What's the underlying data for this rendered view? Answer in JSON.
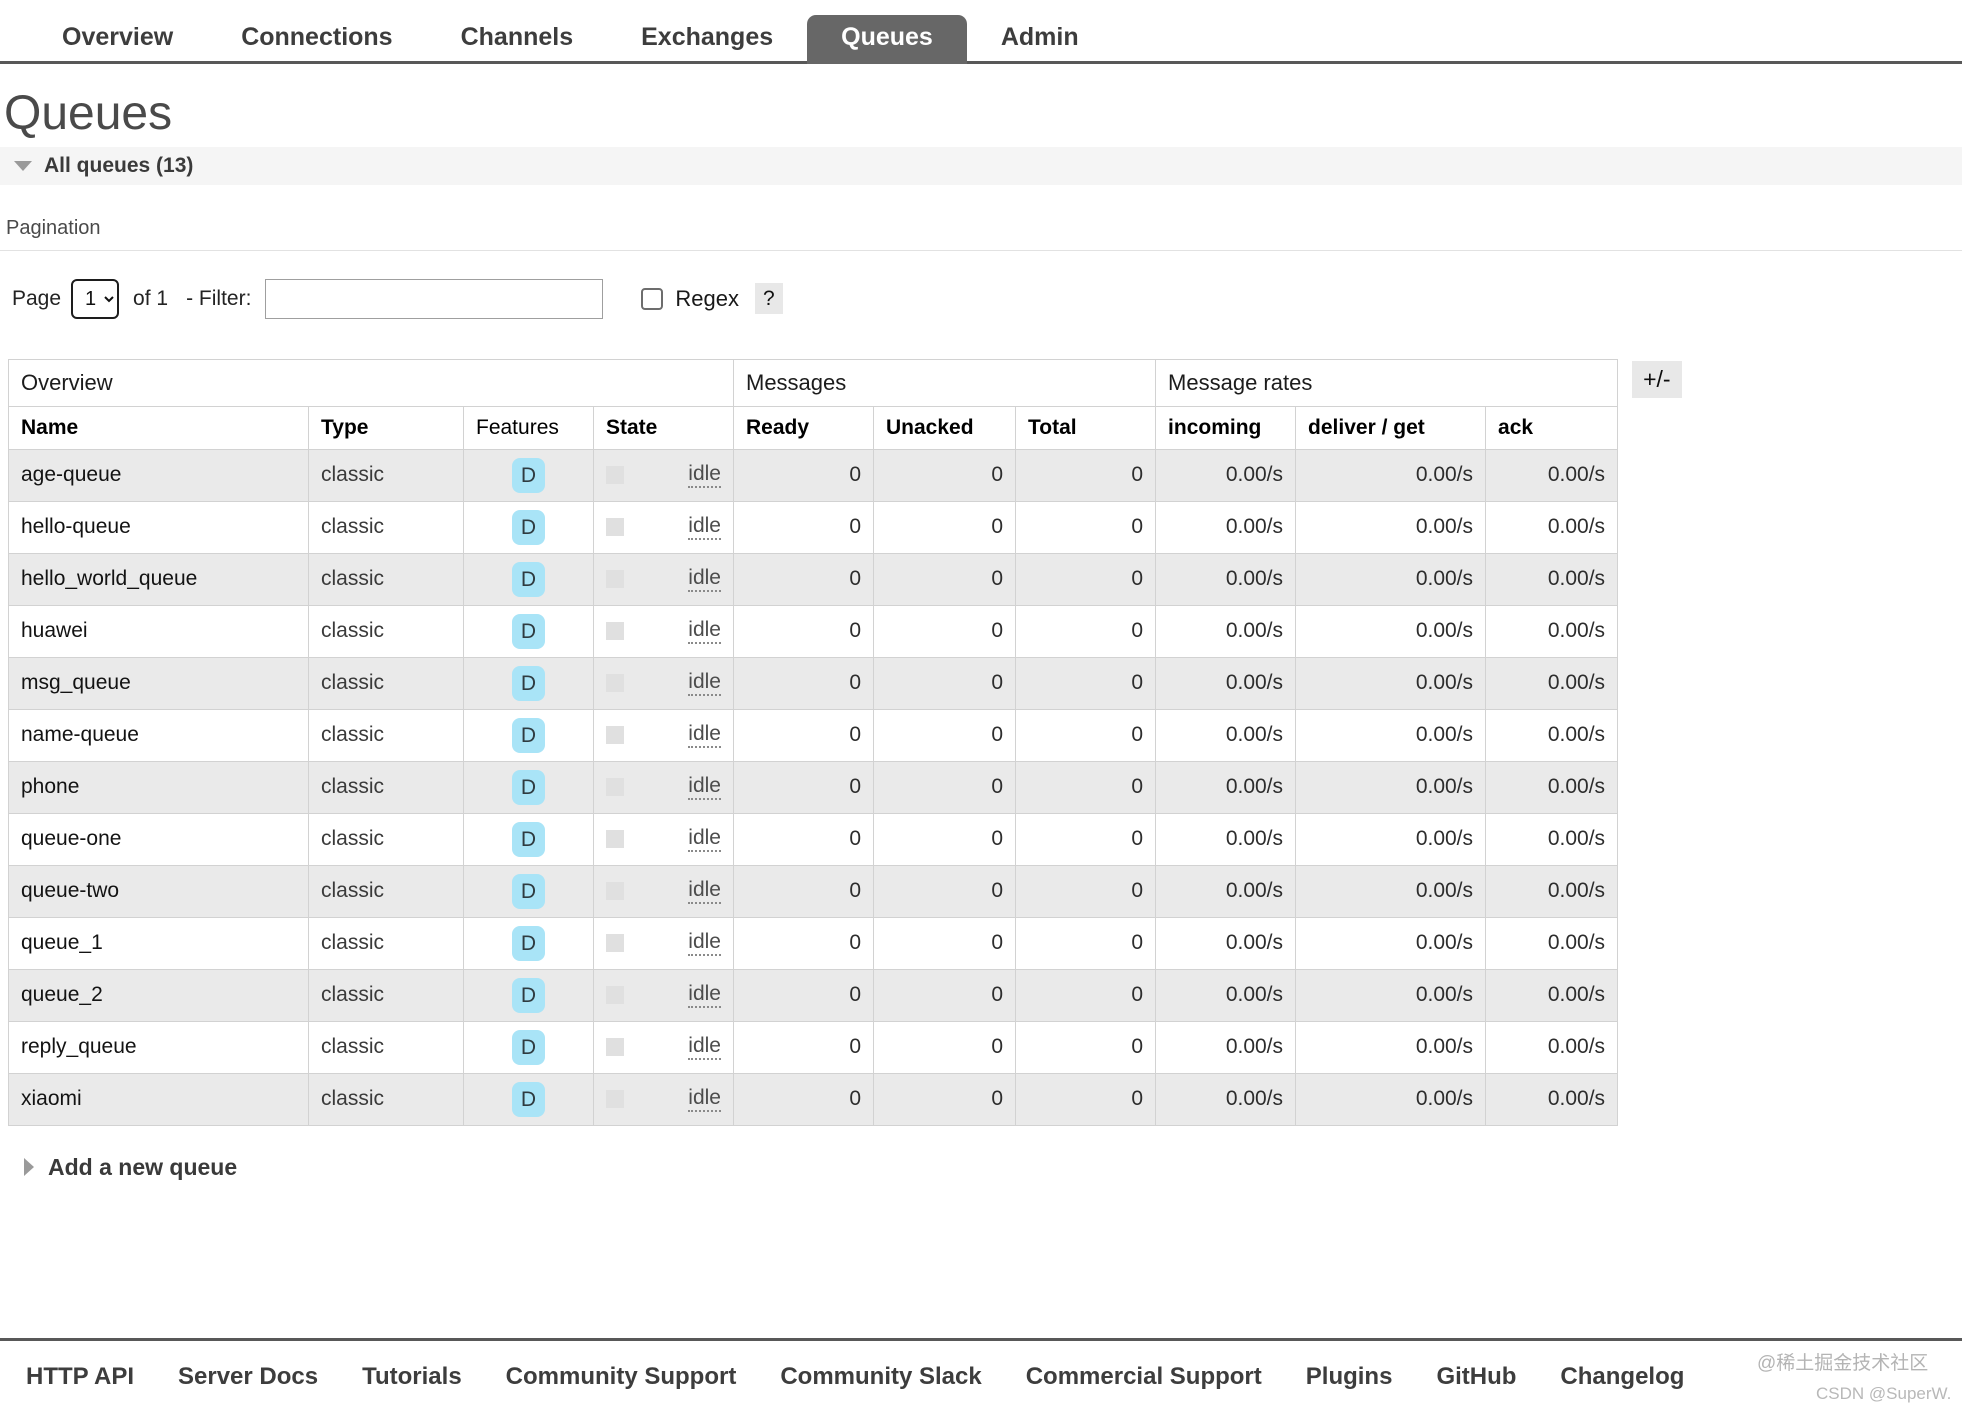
{
  "nav": {
    "tabs": [
      {
        "label": "Overview",
        "active": false
      },
      {
        "label": "Connections",
        "active": false
      },
      {
        "label": "Channels",
        "active": false
      },
      {
        "label": "Exchanges",
        "active": false
      },
      {
        "label": "Queues",
        "active": true
      },
      {
        "label": "Admin",
        "active": false
      }
    ]
  },
  "page": {
    "title": "Queues",
    "section_label": "All queues (13)"
  },
  "pagination": {
    "header": "Pagination",
    "page_label": "Page",
    "page_value": "1",
    "page_options": [
      "1"
    ],
    "of_count": "of 1",
    "filter_label": "- Filter:",
    "filter_value": "",
    "filter_placeholder": "",
    "regex_label": "Regex",
    "regex_checked": false,
    "help_label": "?"
  },
  "table": {
    "group_headers": [
      {
        "label": "Overview",
        "colspan": 4
      },
      {
        "label": "Messages",
        "colspan": 3
      },
      {
        "label": "Message rates",
        "colspan": 3
      }
    ],
    "columns": [
      {
        "label": "Name",
        "sortable": true
      },
      {
        "label": "Type",
        "sortable": true
      },
      {
        "label": "Features",
        "sortable": false
      },
      {
        "label": "State",
        "sortable": true
      },
      {
        "label": "Ready",
        "sortable": true
      },
      {
        "label": "Unacked",
        "sortable": true
      },
      {
        "label": "Total",
        "sortable": true
      },
      {
        "label": "incoming",
        "sortable": true
      },
      {
        "label": "deliver / get",
        "sortable": true
      },
      {
        "label": "ack",
        "sortable": true
      }
    ],
    "plusminus_label": "+/-",
    "rows": [
      {
        "name": "age-queue",
        "type": "classic",
        "features": "D",
        "state": "idle",
        "ready": "0",
        "unacked": "0",
        "total": "0",
        "incoming": "0.00/s",
        "deliver_get": "0.00/s",
        "ack": "0.00/s"
      },
      {
        "name": "hello-queue",
        "type": "classic",
        "features": "D",
        "state": "idle",
        "ready": "0",
        "unacked": "0",
        "total": "0",
        "incoming": "0.00/s",
        "deliver_get": "0.00/s",
        "ack": "0.00/s"
      },
      {
        "name": "hello_world_queue",
        "type": "classic",
        "features": "D",
        "state": "idle",
        "ready": "0",
        "unacked": "0",
        "total": "0",
        "incoming": "0.00/s",
        "deliver_get": "0.00/s",
        "ack": "0.00/s"
      },
      {
        "name": "huawei",
        "type": "classic",
        "features": "D",
        "state": "idle",
        "ready": "0",
        "unacked": "0",
        "total": "0",
        "incoming": "0.00/s",
        "deliver_get": "0.00/s",
        "ack": "0.00/s"
      },
      {
        "name": "msg_queue",
        "type": "classic",
        "features": "D",
        "state": "idle",
        "ready": "0",
        "unacked": "0",
        "total": "0",
        "incoming": "0.00/s",
        "deliver_get": "0.00/s",
        "ack": "0.00/s"
      },
      {
        "name": "name-queue",
        "type": "classic",
        "features": "D",
        "state": "idle",
        "ready": "0",
        "unacked": "0",
        "total": "0",
        "incoming": "0.00/s",
        "deliver_get": "0.00/s",
        "ack": "0.00/s"
      },
      {
        "name": "phone",
        "type": "classic",
        "features": "D",
        "state": "idle",
        "ready": "0",
        "unacked": "0",
        "total": "0",
        "incoming": "0.00/s",
        "deliver_get": "0.00/s",
        "ack": "0.00/s"
      },
      {
        "name": "queue-one",
        "type": "classic",
        "features": "D",
        "state": "idle",
        "ready": "0",
        "unacked": "0",
        "total": "0",
        "incoming": "0.00/s",
        "deliver_get": "0.00/s",
        "ack": "0.00/s"
      },
      {
        "name": "queue-two",
        "type": "classic",
        "features": "D",
        "state": "idle",
        "ready": "0",
        "unacked": "0",
        "total": "0",
        "incoming": "0.00/s",
        "deliver_get": "0.00/s",
        "ack": "0.00/s"
      },
      {
        "name": "queue_1",
        "type": "classic",
        "features": "D",
        "state": "idle",
        "ready": "0",
        "unacked": "0",
        "total": "0",
        "incoming": "0.00/s",
        "deliver_get": "0.00/s",
        "ack": "0.00/s"
      },
      {
        "name": "queue_2",
        "type": "classic",
        "features": "D",
        "state": "idle",
        "ready": "0",
        "unacked": "0",
        "total": "0",
        "incoming": "0.00/s",
        "deliver_get": "0.00/s",
        "ack": "0.00/s"
      },
      {
        "name": "reply_queue",
        "type": "classic",
        "features": "D",
        "state": "idle",
        "ready": "0",
        "unacked": "0",
        "total": "0",
        "incoming": "0.00/s",
        "deliver_get": "0.00/s",
        "ack": "0.00/s"
      },
      {
        "name": "xiaomi",
        "type": "classic",
        "features": "D",
        "state": "idle",
        "ready": "0",
        "unacked": "0",
        "total": "0",
        "incoming": "0.00/s",
        "deliver_get": "0.00/s",
        "ack": "0.00/s"
      }
    ]
  },
  "add_queue": {
    "label": "Add a new queue"
  },
  "footer": {
    "links": [
      "HTTP API",
      "Server Docs",
      "Tutorials",
      "Community Support",
      "Community Slack",
      "Commercial Support",
      "Plugins",
      "GitHub",
      "Changelog"
    ]
  },
  "watermarks": {
    "cn": "@稀土掘金技术社区",
    "csdn": "CSDN @SuperW."
  },
  "colors": {
    "active_tab_bg": "#676767",
    "badge_durable_bg": "#a9e4f7",
    "row_stripe": "#eaeaea",
    "band_bg": "#f5f5f5",
    "rule": "#585858"
  }
}
